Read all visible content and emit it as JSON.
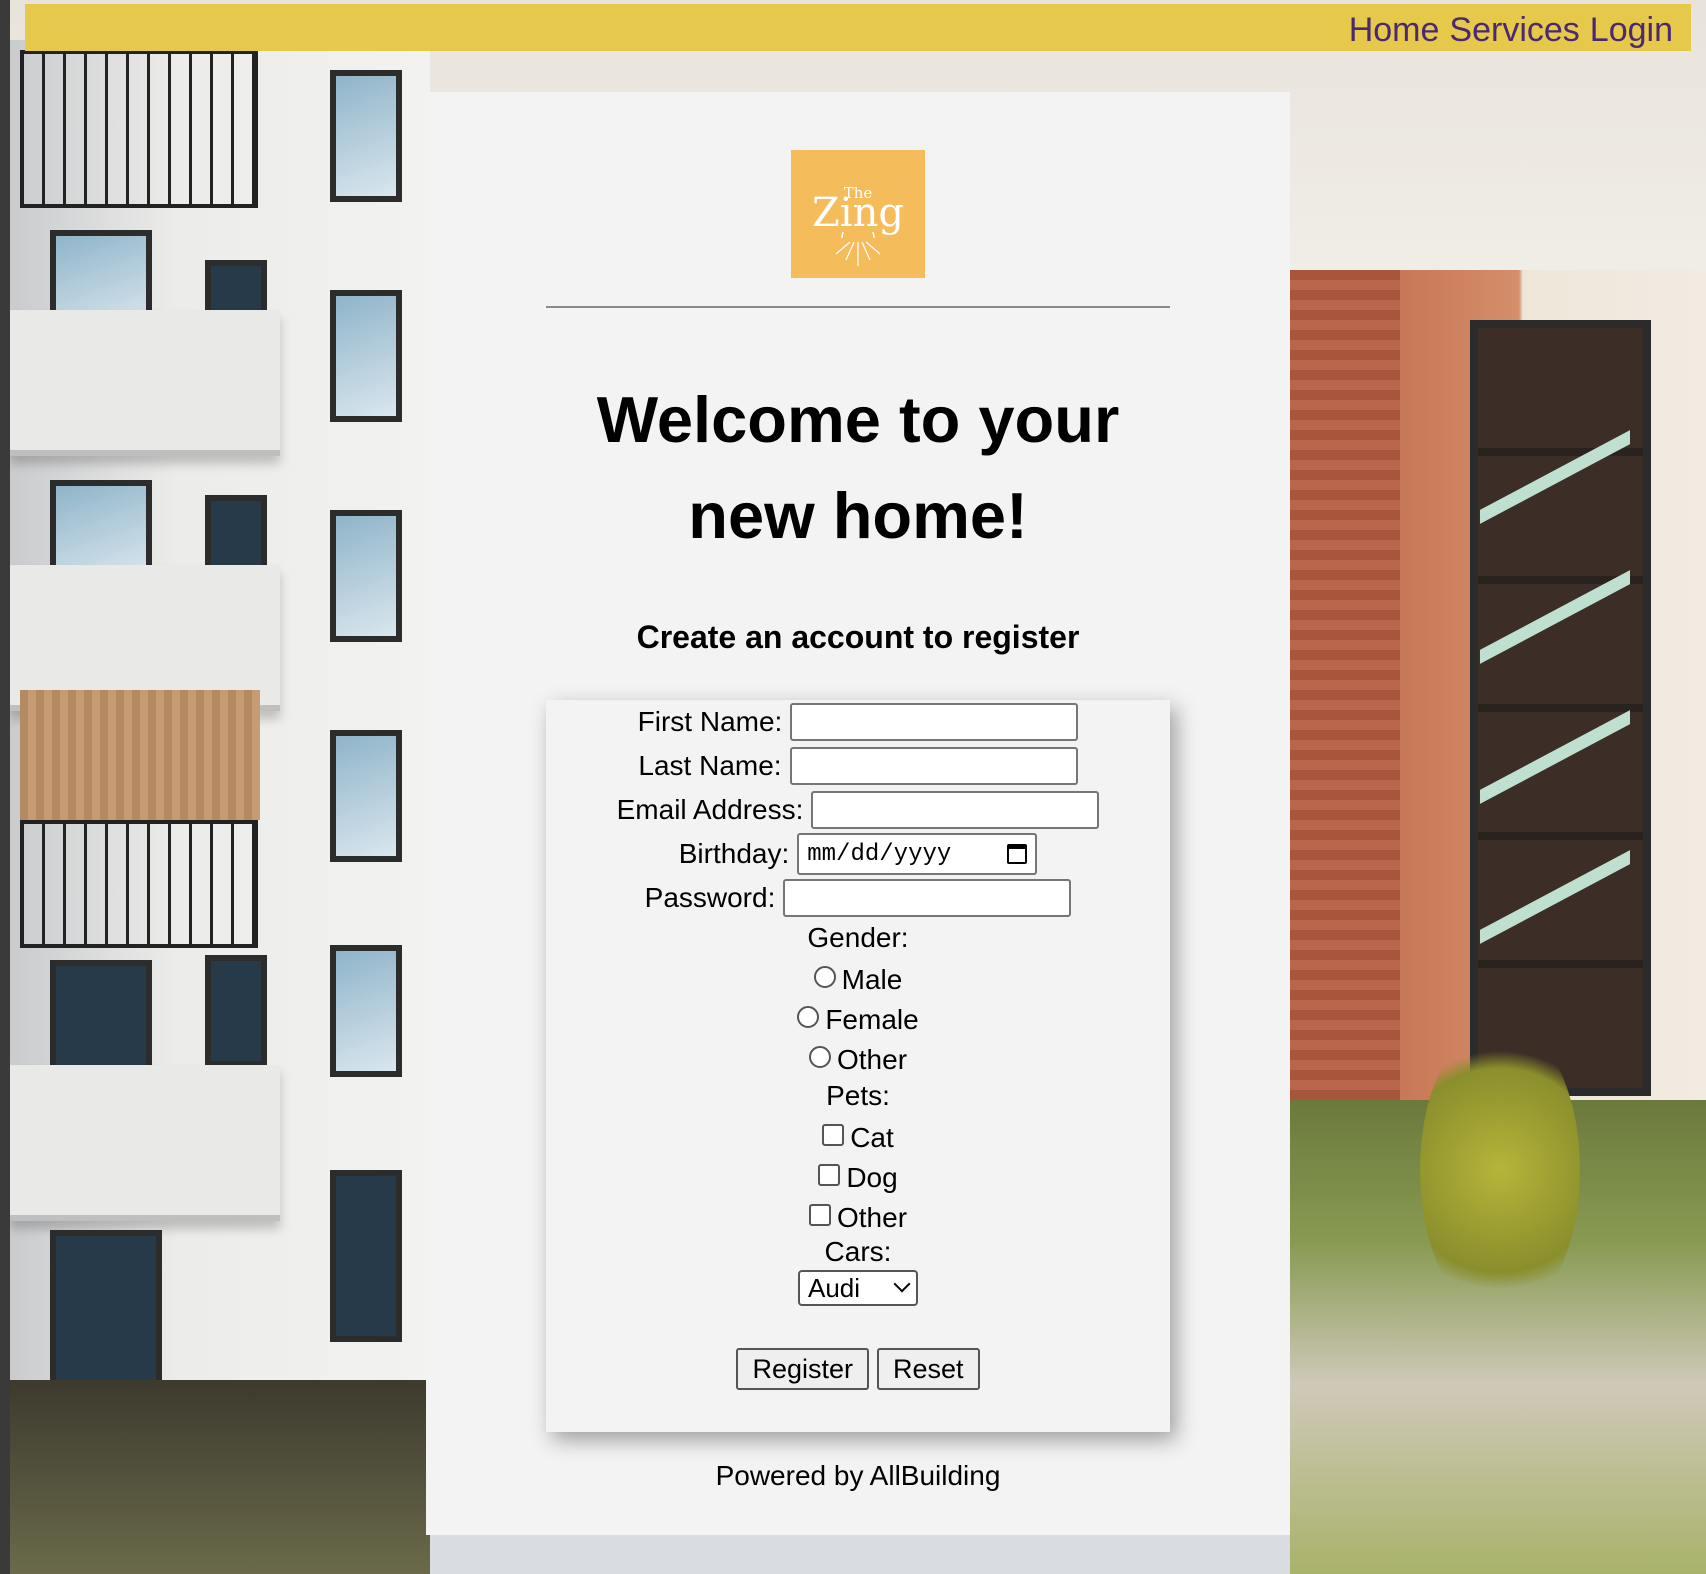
{
  "nav": {
    "items": [
      "Home",
      "Services",
      "Login"
    ]
  },
  "hero": {
    "logo_text_small": "The",
    "logo_text_large": "Zing",
    "title_line1": "Welcome to your",
    "title_line2": "new home!",
    "subtitle": "Create an account to register"
  },
  "form": {
    "first_name_label": "First Name:",
    "first_name_value": "",
    "last_name_label": "Last Name:",
    "last_name_value": "",
    "email_label": "Email Address:",
    "email_value": "",
    "birthday_label": "Birthday:",
    "birthday_placeholder": "mm/dd/yyyy",
    "password_label": "Password:",
    "password_value": "",
    "gender_label": "Gender:",
    "gender_options": [
      "Male",
      "Female",
      "Other"
    ],
    "pets_label": "Pets:",
    "pet_options": [
      "Cat",
      "Dog",
      "Other"
    ],
    "cars_label": "Cars:",
    "cars_selected": "Audi",
    "register_label": "Register",
    "reset_label": "Reset"
  },
  "footer": {
    "text": "Powered by AllBuilding"
  },
  "colors": {
    "topbar": "#e6c84a",
    "nav_text": "#4a2872",
    "logo_bg": "#f5bc5c",
    "panel_bg": "#f3f3f3"
  },
  "icons": {
    "calendar": "calendar-icon",
    "dropdown": "chevron-down-icon"
  }
}
